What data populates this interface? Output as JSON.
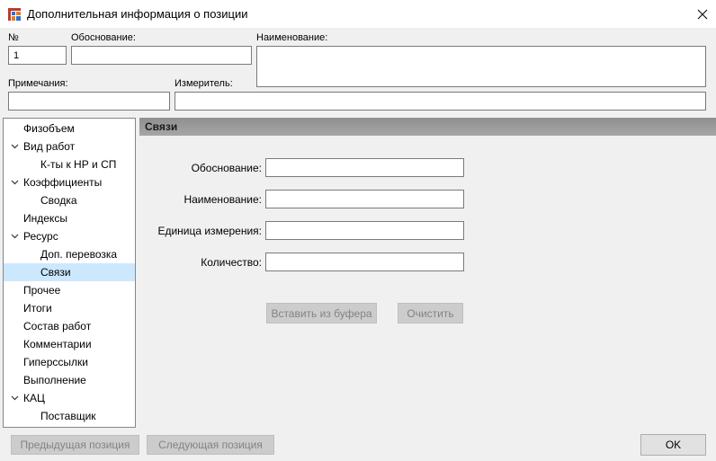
{
  "window": {
    "title": "Дополнительная информация о позиции"
  },
  "header": {
    "num_label": "№",
    "num_value": "1",
    "osnovanie_label": "Обоснование:",
    "osnovanie_value": "",
    "naimenovanie_label": "Наименование:",
    "naimenovanie_value": "",
    "primechaniya_label": "Примечания:",
    "primechaniya_value": "",
    "izmeritel_label": "Измеритель:",
    "izmeritel_value": ""
  },
  "tree": {
    "items": [
      {
        "label": "Физобъем",
        "level": 0,
        "expandable": false
      },
      {
        "label": "Вид работ",
        "level": 0,
        "expandable": true
      },
      {
        "label": "К-ты к НР и СП",
        "level": 1,
        "expandable": false
      },
      {
        "label": "Коэффициенты",
        "level": 0,
        "expandable": true
      },
      {
        "label": "Сводка",
        "level": 1,
        "expandable": false
      },
      {
        "label": "Индексы",
        "level": 0,
        "expandable": false
      },
      {
        "label": "Ресурс",
        "level": 0,
        "expandable": true
      },
      {
        "label": "Доп. перевозка",
        "level": 1,
        "expandable": false
      },
      {
        "label": "Связи",
        "level": 1,
        "expandable": false,
        "selected": true
      },
      {
        "label": "Прочее",
        "level": 0,
        "expandable": false
      },
      {
        "label": "Итоги",
        "level": 0,
        "expandable": false
      },
      {
        "label": "Состав работ",
        "level": 0,
        "expandable": false
      },
      {
        "label": "Комментарии",
        "level": 0,
        "expandable": false
      },
      {
        "label": "Гиперссылки",
        "level": 0,
        "expandable": false
      },
      {
        "label": "Выполнение",
        "level": 0,
        "expandable": false
      },
      {
        "label": "КАЦ",
        "level": 0,
        "expandable": true
      },
      {
        "label": "Поставщик",
        "level": 1,
        "expandable": false
      }
    ]
  },
  "panel": {
    "title": "Связи",
    "fields": [
      {
        "label": "Обоснование:",
        "value": ""
      },
      {
        "label": "Наименование:",
        "value": ""
      },
      {
        "label": "Единица измерения:",
        "value": ""
      },
      {
        "label": "Количество:",
        "value": ""
      }
    ],
    "paste_button": "Вставить из буфера",
    "clear_button": "Очистить"
  },
  "footer": {
    "prev_button": "Предыдущая позиция",
    "next_button": "Следующая позиция",
    "ok_button": "OK"
  },
  "icons": {
    "app": "app-table-icon",
    "close": "close-icon",
    "expand": "chevron-down-icon"
  },
  "colors": {
    "selection": "#cce8ff",
    "panel_header": "#9a9a9a",
    "disabled_button": "#cccccc"
  }
}
